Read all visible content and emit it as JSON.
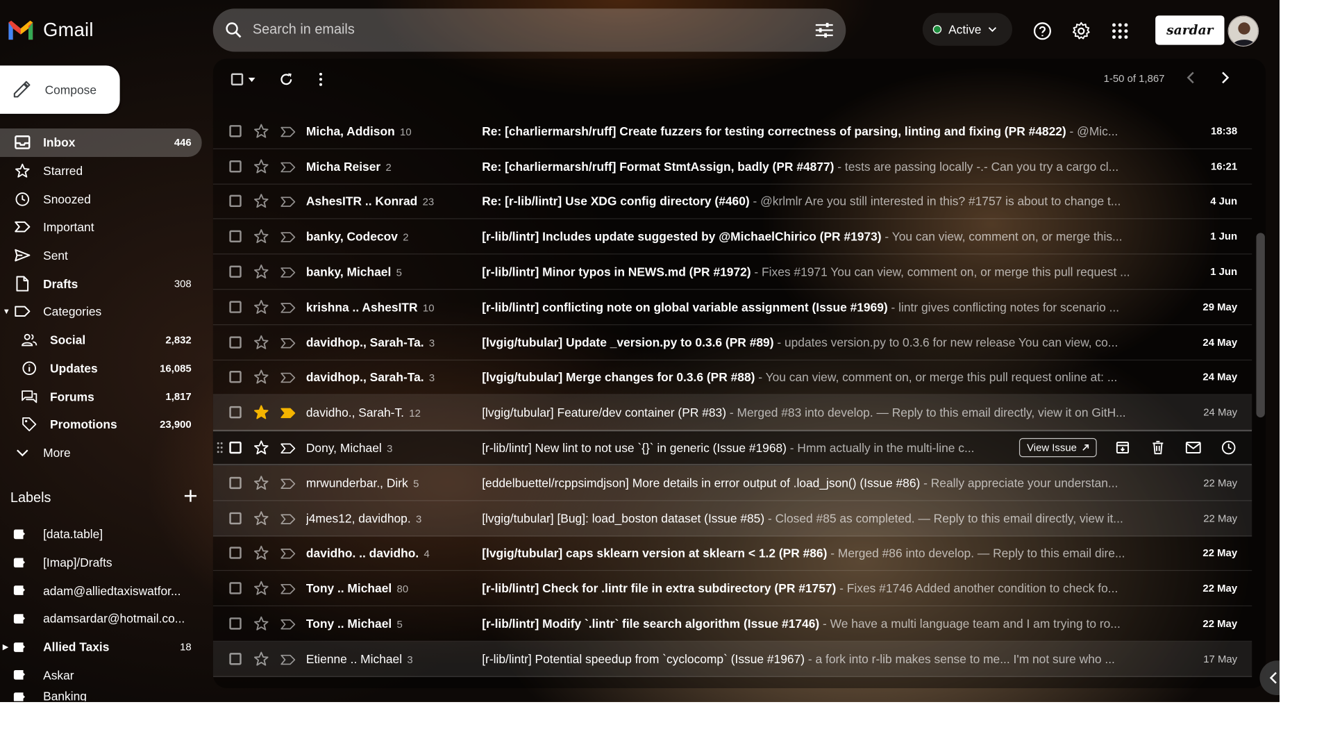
{
  "app": {
    "name": "Gmail"
  },
  "compose": {
    "label": "Compose"
  },
  "nav": [
    {
      "label": "Inbox",
      "count": "446",
      "icon": "inbox-icon",
      "active": true
    },
    {
      "label": "Starred",
      "count": "",
      "icon": "star-icon"
    },
    {
      "label": "Snoozed",
      "count": "",
      "icon": "clock-icon"
    },
    {
      "label": "Important",
      "count": "",
      "icon": "important-icon"
    },
    {
      "label": "Sent",
      "count": "",
      "icon": "send-icon"
    },
    {
      "label": "Drafts",
      "count": "308",
      "icon": "draft-icon",
      "bold": true
    },
    {
      "label": "Categories",
      "count": "",
      "icon": "label-outline-icon"
    },
    {
      "label": "Social",
      "count": "2,832",
      "icon": "people-icon",
      "sub": true
    },
    {
      "label": "Updates",
      "count": "16,085",
      "icon": "info-icon",
      "sub": true
    },
    {
      "label": "Forums",
      "count": "1,817",
      "icon": "forum-icon",
      "sub": true
    },
    {
      "label": "Promotions",
      "count": "23,900",
      "icon": "tag-icon",
      "sub": true
    },
    {
      "label": "More",
      "count": "",
      "icon": "chevron-down-icon"
    }
  ],
  "labels_section": {
    "title": "Labels",
    "items": [
      {
        "label": "[data.table]",
        "count": ""
      },
      {
        "label": "[Imap]/Drafts",
        "count": ""
      },
      {
        "label": "adam@alliedtaxiswatfor...",
        "count": ""
      },
      {
        "label": "adamsardar@hotmail.co...",
        "count": ""
      },
      {
        "label": "Allied Taxis",
        "count": "18",
        "bold": true
      },
      {
        "label": "Askar",
        "count": ""
      },
      {
        "label": "Banking",
        "count": ""
      }
    ]
  },
  "search": {
    "placeholder": "Search in emails"
  },
  "status": {
    "label": "Active",
    "color": "#1e8e3e"
  },
  "account": {
    "brand": "sardar"
  },
  "toolbar": {
    "range": "1-50 of 1,867"
  },
  "emails": [
    {
      "sender": "Micha, Addison",
      "count": "10",
      "subject": "Re: [charliermarsh/ruff] Create fuzzers for testing correctness of parsing, linting and fixing (PR #4822)",
      "snippet": " - @Mic...",
      "date": "18:38",
      "unread": true
    },
    {
      "sender": "Micha Reiser",
      "count": "2",
      "subject": "Re: [charliermarsh/ruff] Format StmtAssign, badly (PR #4877)",
      "snippet": " - tests are passing locally -.- Can you try a cargo cl...",
      "date": "16:21",
      "unread": true
    },
    {
      "sender": "AshesITR .. Konrad",
      "count": "23",
      "subject": "Re: [r-lib/lintr] Use XDG config directory (#460)",
      "snippet": " - @krlmlr Are you still interested in this? #1757 is about to change t...",
      "date": "4 Jun",
      "unread": true
    },
    {
      "sender": "banky, Codecov",
      "count": "2",
      "subject": "[r-lib/lintr] Includes update suggested by @MichaelChirico (PR #1973)",
      "snippet": " - You can view, comment on, or merge this...",
      "date": "1 Jun",
      "unread": true
    },
    {
      "sender": "banky, Michael",
      "count": "5",
      "subject": "[r-lib/lintr] Minor typos in NEWS.md (PR #1972)",
      "snippet": " - Fixes #1971 You can view, comment on, or merge this pull request ...",
      "date": "1 Jun",
      "unread": true
    },
    {
      "sender": "krishna .. AshesITR",
      "count": "10",
      "subject": "[r-lib/lintr] conflicting note on global variable assignment (Issue #1969)",
      "snippet": " - lintr gives conflicting notes for scenario ...",
      "date": "29 May",
      "unread": true
    },
    {
      "sender": "davidhop., Sarah-Ta.",
      "count": "3",
      "subject": "[lvgig/tubular] Update _version.py to 0.3.6 (PR #89)",
      "snippet": " - updates version.py to 0.3.6 for new release You can view, co...",
      "date": "24 May",
      "unread": true
    },
    {
      "sender": "davidhop., Sarah-Ta.",
      "count": "3",
      "subject": "[lvgig/tubular] Merge changes for 0.3.6 (PR #88)",
      "snippet": " - You can view, comment on, or merge this pull request online at: ...",
      "date": "24 May",
      "unread": true
    },
    {
      "sender": "davidho., Sarah-T.",
      "count": "12",
      "subject": "[lvgig/tubular] Feature/dev container (PR #83)",
      "snippet": " - Merged #83 into develop. — Reply to this email directly, view it on GitH...",
      "date": "24 May",
      "unread": false,
      "starred": true,
      "important": true
    },
    {
      "sender": "Dony, Michael",
      "count": "3",
      "subject": "[r-lib/lintr] New lint to not use `{}` in generic (Issue #1968)",
      "snippet": " - Hmm actually in the multi-line c...",
      "date": "",
      "unread": false,
      "hover": true
    },
    {
      "sender": "mrwunderbar., Dirk",
      "count": "5",
      "subject": "[eddelbuettel/rcppsimdjson] More details in error output of .load_json() (Issue #86)",
      "snippet": " - Really appreciate your understan...",
      "date": "22 May",
      "unread": false
    },
    {
      "sender": "j4mes12, davidhop.",
      "count": "3",
      "subject": "[lvgig/tubular] [Bug]: load_boston dataset (Issue #85)",
      "snippet": " - Closed #85 as completed. — Reply to this email directly, view it...",
      "date": "22 May",
      "unread": false
    },
    {
      "sender": "davidho. .. davidho.",
      "count": "4",
      "subject": "[lvgig/tubular] caps sklearn version at sklearn < 1.2 (PR #86)",
      "snippet": " - Merged #86 into develop. — Reply to this email dire...",
      "date": "22 May",
      "unread": true
    },
    {
      "sender": "Tony .. Michael",
      "count": "80",
      "subject": "[r-lib/lintr] Check for .lintr file in extra subdirectory (PR #1757)",
      "snippet": " - Fixes #1746 Added another condition to check fo...",
      "date": "22 May",
      "unread": true
    },
    {
      "sender": "Tony .. Michael",
      "count": "5",
      "subject": "[r-lib/lintr] Modify `.lintr` file search algorithm (Issue #1746)",
      "snippet": " - We have a multi language team and I am trying to ro...",
      "date": "22 May",
      "unread": true
    },
    {
      "sender": "Etienne .. Michael",
      "count": "3",
      "subject": "[r-lib/lintr] Potential speedup from `cyclocomp` (Issue #1967)",
      "snippet": " - a fork into r-lib makes sense to me... I'm not sure who ...",
      "date": "17 May",
      "unread": false
    }
  ],
  "hover_actions": {
    "chip_label": "View Issue"
  }
}
